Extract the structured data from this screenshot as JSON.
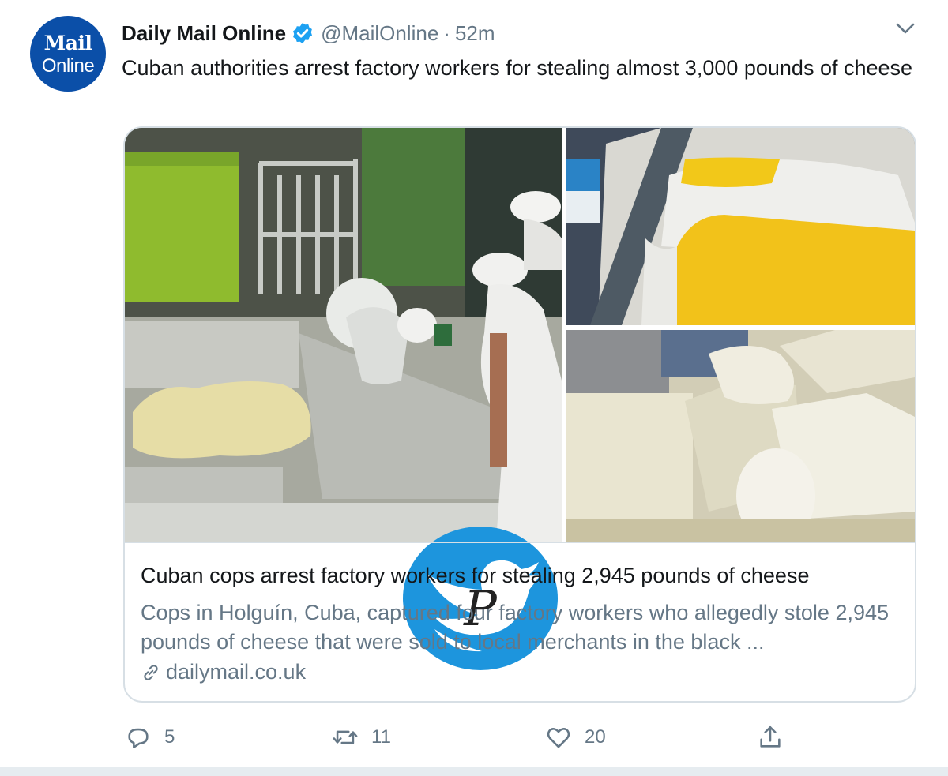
{
  "tweet": {
    "avatar": {
      "line1": "Mail",
      "line2": "Online",
      "color": "#0b4fa8"
    },
    "display_name": "Daily Mail Online",
    "verified_icon": "verified-badge-icon",
    "handle": "@MailOnline",
    "separator": "·",
    "time": "52m",
    "menu_icon": "chevron-down-icon",
    "text": "Cuban authorities arrest factory workers for stealing almost 3,000 pounds of cheese"
  },
  "card": {
    "images": [
      "cheese-factory-workers-image",
      "cheese-bags-image",
      "cheese-blocks-image"
    ],
    "title": "Cuban cops arrest factory workers for stealing 2,945 pounds of cheese",
    "description": "Cops in Holguín, Cuba, captured four factory workers who allegedly stole 2,945 pounds of cheese that were sold to local merchants in the black ...",
    "domain": "dailymail.co.uk",
    "domain_icon": "link-icon"
  },
  "actions": {
    "reply_count": "5",
    "retweet_count": "11",
    "like_count": "20",
    "icons": [
      "reply-icon",
      "retweet-icon",
      "like-icon",
      "share-icon"
    ]
  },
  "watermark": {
    "icon": "twitter-bird-watermark-icon",
    "letter": "P",
    "color": "#1d95dd"
  },
  "colors": {
    "text": "#14171a",
    "secondary": "#657786",
    "border": "#d7dfe5",
    "verified": "#1da1f2"
  }
}
